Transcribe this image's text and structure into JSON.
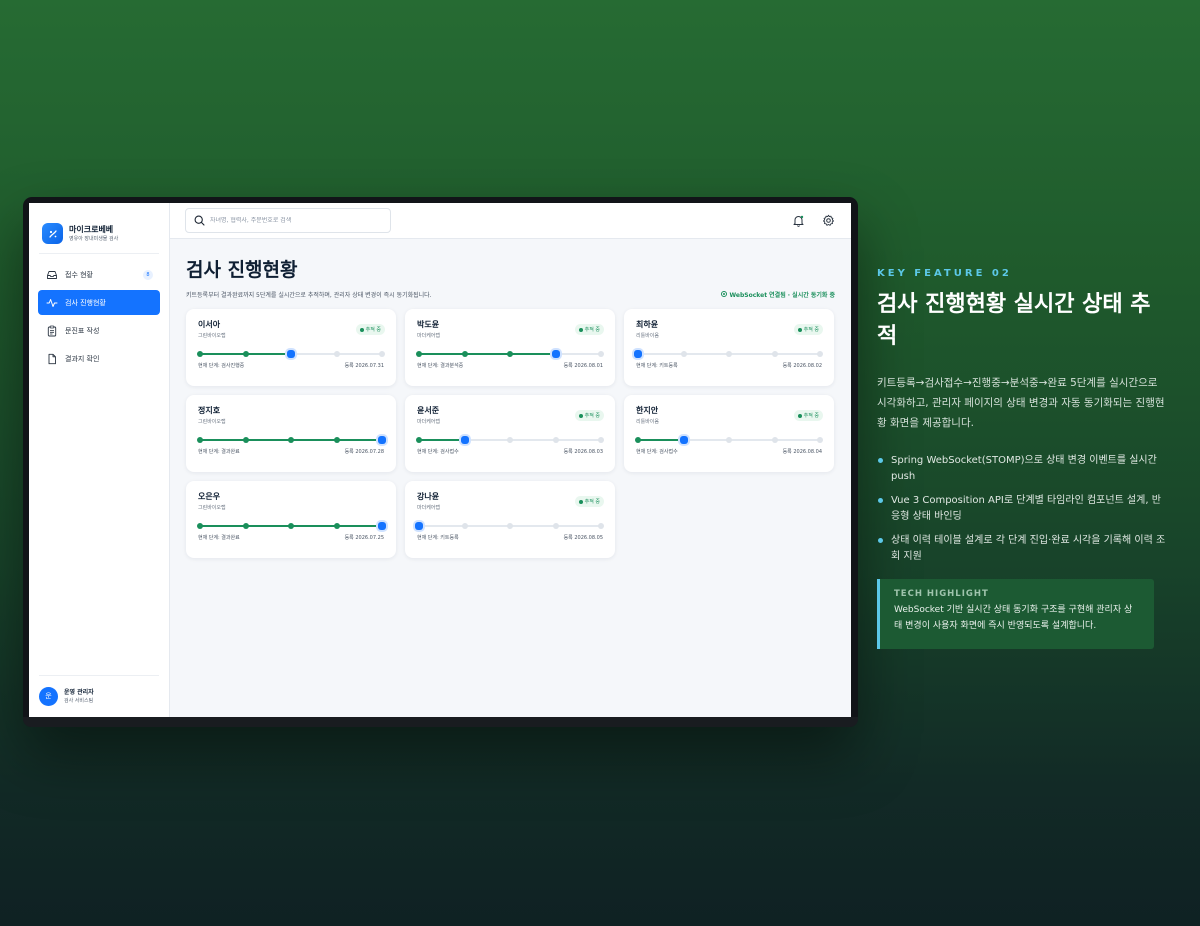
{
  "app": {
    "brand_name": "마이크로베베",
    "brand_sub": "영유아 장내미생물 검사"
  },
  "sidebar": {
    "items": [
      {
        "label": "접수 현황",
        "icon": "inbox-icon",
        "badge": "8",
        "active": false
      },
      {
        "label": "검사 진행현황",
        "icon": "activity-icon",
        "active": true
      },
      {
        "label": "문진표 작성",
        "icon": "clipboard-icon",
        "active": false
      },
      {
        "label": "결과지 확인",
        "icon": "file-icon",
        "active": false
      }
    ],
    "user": {
      "avatar": "운",
      "name": "운영 관리자",
      "role": "검사 서비스팀"
    }
  },
  "topbar": {
    "search_placeholder": "자녀명, 협력사, 주문번호로 검색"
  },
  "page": {
    "title": "검사 진행현황",
    "subtitle": "키트등록부터 결과완료까지 5단계를 실시간으로 추적하며, 관리자 상태 변경이 즉시 동기화됩니다.",
    "ws_status": "WebSocket 연결됨 · 실시간 동기화 중"
  },
  "cards": [
    {
      "name": "이서아",
      "org": "그린바이오랩",
      "chip": "추적 중",
      "completed": 2,
      "current": 3,
      "stage": "현재 단계: 검사진행중",
      "date": "등록 2026.07.31"
    },
    {
      "name": "박도윤",
      "org": "마더케어랩",
      "chip": "추적 중",
      "completed": 3,
      "current": 4,
      "stage": "현재 단계: 결과분석중",
      "date": "등록 2026.08.01"
    },
    {
      "name": "최하윤",
      "org": "리틀바이옴",
      "chip": "추적 중",
      "completed": 0,
      "current": 1,
      "stage": "현재 단계: 키트등록",
      "date": "등록 2026.08.02"
    },
    {
      "name": "정지호",
      "org": "그린바이오랩",
      "chip": "",
      "completed": 4,
      "current": 5,
      "stage": "현재 단계: 결과완료",
      "date": "등록 2026.07.28"
    },
    {
      "name": "윤서준",
      "org": "마더케어랩",
      "chip": "추적 중",
      "completed": 1,
      "current": 2,
      "stage": "현재 단계: 검사접수",
      "date": "등록 2026.08.03"
    },
    {
      "name": "한지안",
      "org": "리틀바이옴",
      "chip": "추적 중",
      "completed": 1,
      "current": 2,
      "stage": "현재 단계: 검사접수",
      "date": "등록 2026.08.04"
    },
    {
      "name": "오은우",
      "org": "그린바이오랩",
      "chip": "",
      "completed": 4,
      "current": 5,
      "stage": "현재 단계: 결과완료",
      "date": "등록 2026.07.25"
    },
    {
      "name": "강나윤",
      "org": "마더케어랩",
      "chip": "추적 중",
      "completed": 0,
      "current": 1,
      "stage": "현재 단계: 키트등록",
      "date": "등록 2026.08.05"
    }
  ],
  "feature": {
    "kicker": "KEY FEATURE 02",
    "title": "검사 진행현황 실시간 상태 추적",
    "desc": "키트등록→검사접수→진행중→분석중→완료 5단계를 실시간으로 시각화하고, 관리자 페이지의 상태 변경과 자동 동기화되는 진행현황 화면을 제공합니다.",
    "bullets": [
      "Spring WebSocket(STOMP)으로 상태 변경 이벤트를 실시간 push",
      "Vue 3 Composition API로 단계별 타임라인 컴포넌트 설계, 반응형 상태 바인딩",
      "상태 이력 테이블 설계로 각 단계 진입·완료 시각을 기록해 이력 조회 지원"
    ],
    "tech_title": "TECH HIGHLIGHT",
    "tech_body": "WebSocket 기반 실시간 상태 동기화 구조를 구현해 관리자 상태 변경이 사용자 화면에 즉시 반영되도록 설계합니다."
  },
  "colors": {
    "accent": "#1473ff",
    "done": "#1a8f5b",
    "kicker": "#5cc8e8"
  }
}
